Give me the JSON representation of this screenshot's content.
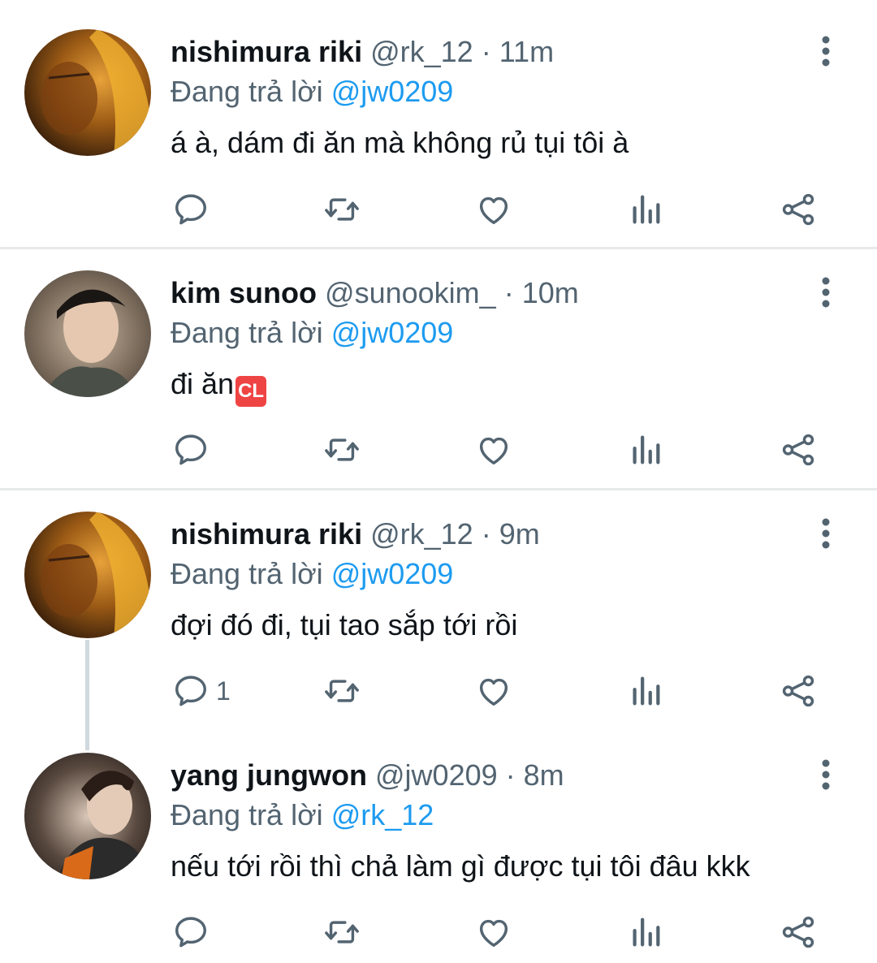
{
  "colors": {
    "text": "#0f1419",
    "secondary": "#536471",
    "link": "#1d9bf0",
    "divider": "#e7e9ea"
  },
  "icons": [
    "reply-icon",
    "retweet-icon",
    "like-icon",
    "views-icon",
    "share-icon",
    "more-icon"
  ],
  "tweets": [
    {
      "name": "nishimura riki",
      "handle": "@rk_12",
      "dot": " · ",
      "time": "11m",
      "replying_label": "Đang trả lời",
      "replying_to": "@jw0209",
      "text": "á à, dám đi ăn mà không rủ tụi tôi à",
      "reply_count": ""
    },
    {
      "name": "kim sunoo",
      "handle": "@sunookim_",
      "dot": " · ",
      "time": "10m",
      "replying_label": "Đang trả lời",
      "replying_to": "@jw0209",
      "text": "đi ăn",
      "badge": "CL",
      "reply_count": ""
    },
    {
      "name": "nishimura riki",
      "handle": "@rk_12",
      "dot": " · ",
      "time": "9m",
      "replying_label": "Đang trả lời",
      "replying_to": "@jw0209",
      "text": "đợi đó đi, tụi tao sắp tới rồi",
      "reply_count": "1"
    },
    {
      "name": "yang jungwon",
      "handle": "@jw0209",
      "dot": " · ",
      "time": "8m",
      "replying_label": "Đang trả lời",
      "replying_to": "@rk_12",
      "text": "nếu tới rồi thì chả làm gì được tụi tôi đâu kkk",
      "reply_count": ""
    }
  ]
}
